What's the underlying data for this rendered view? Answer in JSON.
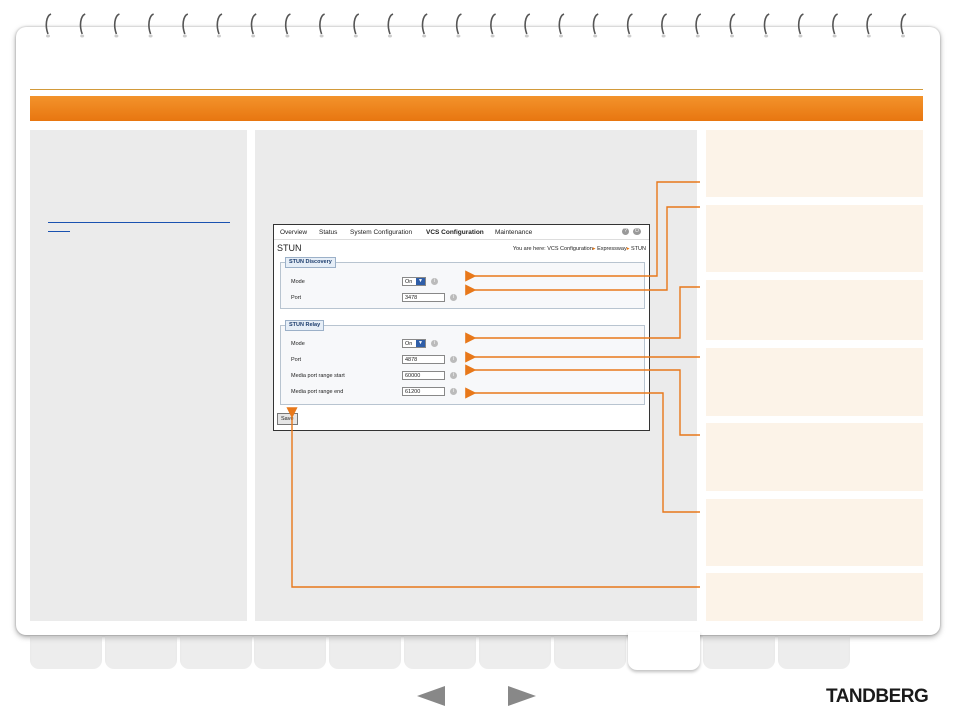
{
  "colors": {
    "accent": "#f0861a",
    "arrow": "#e8781a",
    "side_box": "#fcf3e8",
    "panel": "#ebebeb"
  },
  "left_link_text": "",
  "stun_ui": {
    "nav": [
      "Overview",
      "Status",
      "System Configuration",
      "VCS Configuration",
      "Maintenance"
    ],
    "active_nav": "VCS Configuration",
    "title": "STUN",
    "breadcrumb": {
      "prefix": "You are here:",
      "items": [
        "VCS Configuration",
        "Expressway",
        "STUN"
      ]
    },
    "discovery": {
      "legend": "STUN Discovery",
      "mode_label": "Mode",
      "mode_value": "On",
      "port_label": "Port",
      "port_value": "3478"
    },
    "relay": {
      "legend": "STUN Relay",
      "mode_label": "Mode",
      "mode_value": "On",
      "port_label": "Port",
      "port_value": "4878",
      "start_label": "Media port range start",
      "start_value": "60000",
      "end_label": "Media port range end",
      "end_value": "61200"
    },
    "save_label": "Save",
    "help_icon": "question-icon",
    "logout_icon": "power-icon",
    "info_icon": "info-icon"
  },
  "bottom_tab_count": 11,
  "active_tab_index": 8,
  "nav_prev_icon": "arrow-left-icon",
  "nav_next_icon": "arrow-right-icon",
  "brand": "TANDBERG"
}
